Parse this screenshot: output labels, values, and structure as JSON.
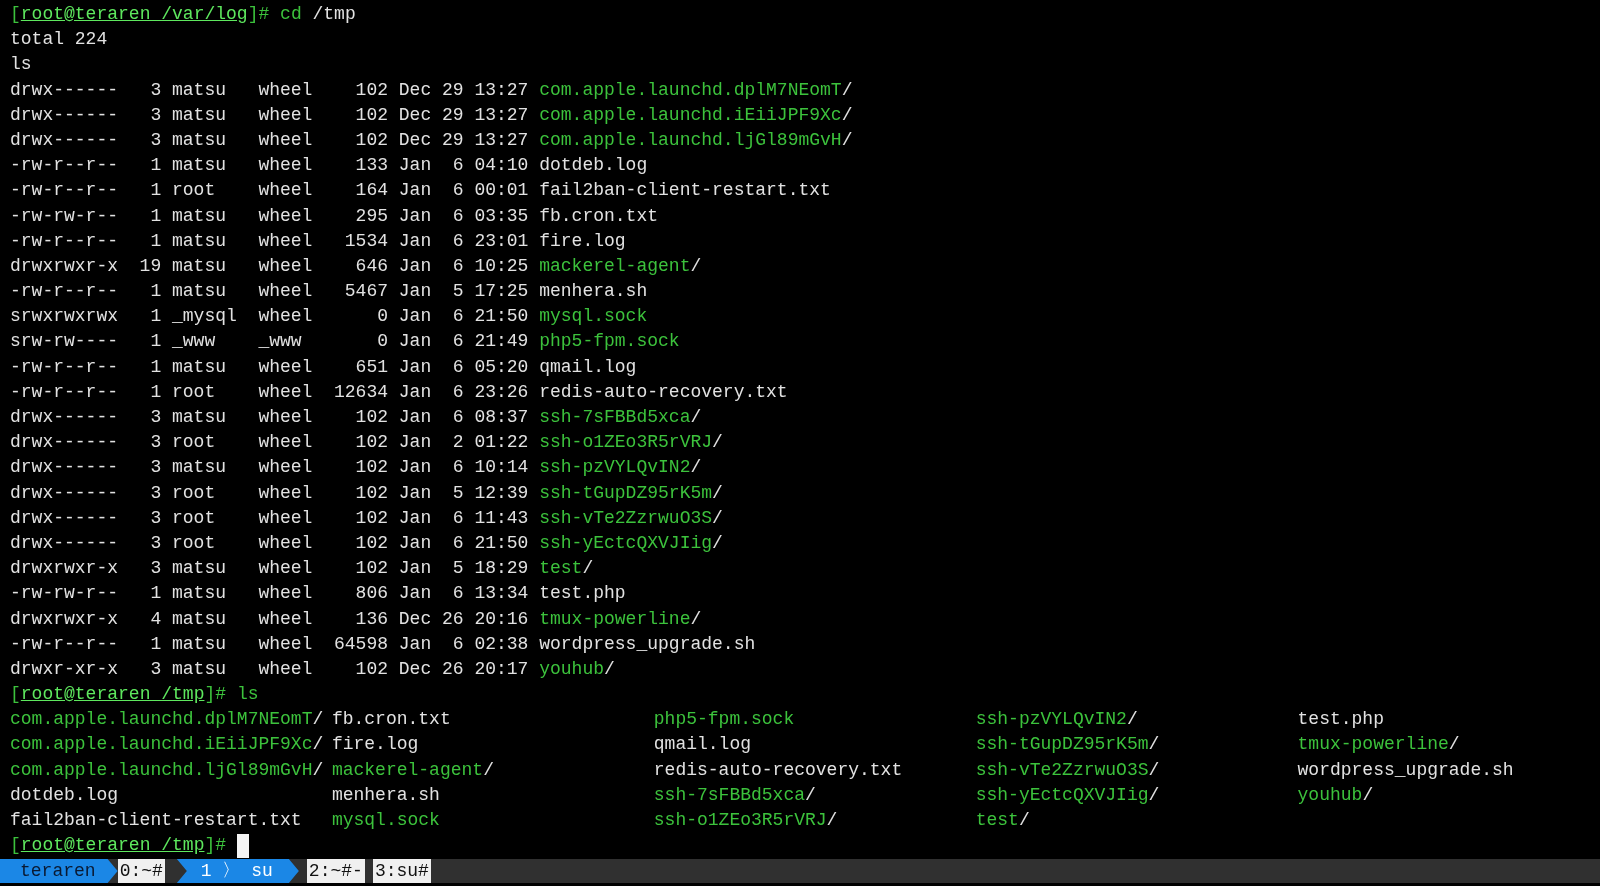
{
  "terminal": {
    "lines": [
      {
        "kind": "prompt",
        "before": "[",
        "location": "root@teraren /var/log",
        "after": "]#",
        "command": "cd",
        "args": "/tmp",
        "cursor": false
      },
      {
        "kind": "text",
        "text": "total 224"
      },
      {
        "kind": "text",
        "text": "ls"
      },
      {
        "kind": "entry",
        "perms": "drwx------",
        "links": "3",
        "owner": "matsu",
        "group": "wheel",
        "size": "102",
        "month": "Dec",
        "day": "29",
        "time": "13:27",
        "name": "com.apple.launchd.dplM7NEomT",
        "suffix": "/",
        "highlight": true
      },
      {
        "kind": "entry",
        "perms": "drwx------",
        "links": "3",
        "owner": "matsu",
        "group": "wheel",
        "size": "102",
        "month": "Dec",
        "day": "29",
        "time": "13:27",
        "name": "com.apple.launchd.iEiiJPF9Xc",
        "suffix": "/",
        "highlight": true
      },
      {
        "kind": "entry",
        "perms": "drwx------",
        "links": "3",
        "owner": "matsu",
        "group": "wheel",
        "size": "102",
        "month": "Dec",
        "day": "29",
        "time": "13:27",
        "name": "com.apple.launchd.ljGl89mGvH",
        "suffix": "/",
        "highlight": true
      },
      {
        "kind": "entry",
        "perms": "-rw-r--r--",
        "links": "1",
        "owner": "matsu",
        "group": "wheel",
        "size": "133",
        "month": "Jan",
        "day": "6",
        "time": "04:10",
        "name": "dotdeb.log",
        "highlight": false
      },
      {
        "kind": "entry",
        "perms": "-rw-r--r--",
        "links": "1",
        "owner": "root",
        "group": "wheel",
        "size": "164",
        "month": "Jan",
        "day": "6",
        "time": "00:01",
        "name": "fail2ban-client-restart.txt",
        "highlight": false
      },
      {
        "kind": "entry",
        "perms": "-rw-rw-r--",
        "links": "1",
        "owner": "matsu",
        "group": "wheel",
        "size": "295",
        "month": "Jan",
        "day": "6",
        "time": "03:35",
        "name": "fb.cron.txt",
        "highlight": false
      },
      {
        "kind": "entry",
        "perms": "-rw-r--r--",
        "links": "1",
        "owner": "matsu",
        "group": "wheel",
        "size": "1534",
        "month": "Jan",
        "day": "6",
        "time": "23:01",
        "name": "fire.log",
        "highlight": false
      },
      {
        "kind": "entry",
        "perms": "drwxrwxr-x",
        "links": "19",
        "owner": "matsu",
        "group": "wheel",
        "size": "646",
        "month": "Jan",
        "day": "6",
        "time": "10:25",
        "name": "mackerel-agent",
        "suffix": "/",
        "highlight": true
      },
      {
        "kind": "entry",
        "perms": "-rw-r--r--",
        "links": "1",
        "owner": "matsu",
        "group": "wheel",
        "size": "5467",
        "month": "Jan",
        "day": "5",
        "time": "17:25",
        "name": "menhera.sh",
        "highlight": false
      },
      {
        "kind": "entry",
        "perms": "srwxrwxrwx",
        "links": "1",
        "owner": "_mysql",
        "group": "wheel",
        "size": "0",
        "month": "Jan",
        "day": "6",
        "time": "21:50",
        "name": "mysql.sock",
        "highlight": true
      },
      {
        "kind": "entry",
        "perms": "srw-rw----",
        "links": "1",
        "owner": "_www",
        "group": "_www",
        "size": "0",
        "month": "Jan",
        "day": "6",
        "time": "21:49",
        "name": "php5-fpm.sock",
        "highlight": true
      },
      {
        "kind": "entry",
        "perms": "-rw-r--r--",
        "links": "1",
        "owner": "matsu",
        "group": "wheel",
        "size": "651",
        "month": "Jan",
        "day": "6",
        "time": "05:20",
        "name": "qmail.log",
        "highlight": false
      },
      {
        "kind": "entry",
        "perms": "-rw-r--r--",
        "links": "1",
        "owner": "root",
        "group": "wheel",
        "size": "12634",
        "month": "Jan",
        "day": "6",
        "time": "23:26",
        "name": "redis-auto-recovery.txt",
        "highlight": false
      },
      {
        "kind": "entry",
        "perms": "drwx------",
        "links": "3",
        "owner": "matsu",
        "group": "wheel",
        "size": "102",
        "month": "Jan",
        "day": "6",
        "time": "08:37",
        "name": "ssh-7sFBBd5xca",
        "suffix": "/",
        "highlight": true
      },
      {
        "kind": "entry",
        "perms": "drwx------",
        "links": "3",
        "owner": "root",
        "group": "wheel",
        "size": "102",
        "month": "Jan",
        "day": "2",
        "time": "01:22",
        "name": "ssh-o1ZEo3R5rVRJ",
        "suffix": "/",
        "highlight": true
      },
      {
        "kind": "entry",
        "perms": "drwx------",
        "links": "3",
        "owner": "matsu",
        "group": "wheel",
        "size": "102",
        "month": "Jan",
        "day": "6",
        "time": "10:14",
        "name": "ssh-pzVYLQvIN2",
        "suffix": "/",
        "highlight": true
      },
      {
        "kind": "entry",
        "perms": "drwx------",
        "links": "3",
        "owner": "root",
        "group": "wheel",
        "size": "102",
        "month": "Jan",
        "day": "5",
        "time": "12:39",
        "name": "ssh-tGupDZ95rK5m",
        "suffix": "/",
        "highlight": true
      },
      {
        "kind": "entry",
        "perms": "drwx------",
        "links": "3",
        "owner": "root",
        "group": "wheel",
        "size": "102",
        "month": "Jan",
        "day": "6",
        "time": "11:43",
        "name": "ssh-vTe2ZzrwuO3S",
        "suffix": "/",
        "highlight": true
      },
      {
        "kind": "entry",
        "perms": "drwx------",
        "links": "3",
        "owner": "root",
        "group": "wheel",
        "size": "102",
        "month": "Jan",
        "day": "6",
        "time": "21:50",
        "name": "ssh-yEctcQXVJIig",
        "suffix": "/",
        "highlight": true
      },
      {
        "kind": "entry",
        "perms": "drwxrwxr-x",
        "links": "3",
        "owner": "matsu",
        "group": "wheel",
        "size": "102",
        "month": "Jan",
        "day": "5",
        "time": "18:29",
        "name": "test",
        "suffix": "/",
        "highlight": true
      },
      {
        "kind": "entry",
        "perms": "-rw-rw-r--",
        "links": "1",
        "owner": "matsu",
        "group": "wheel",
        "size": "806",
        "month": "Jan",
        "day": "6",
        "time": "13:34",
        "name": "test.php",
        "highlight": false
      },
      {
        "kind": "entry",
        "perms": "drwxrwxr-x",
        "links": "4",
        "owner": "matsu",
        "group": "wheel",
        "size": "136",
        "month": "Dec",
        "day": "26",
        "time": "20:16",
        "name": "tmux-powerline",
        "suffix": "/",
        "highlight": true
      },
      {
        "kind": "entry",
        "perms": "-rw-r--r--",
        "links": "1",
        "owner": "matsu",
        "group": "wheel",
        "size": "64598",
        "month": "Jan",
        "day": "6",
        "time": "02:38",
        "name": "wordpress_upgrade.sh",
        "highlight": false
      },
      {
        "kind": "entry",
        "perms": "drwxr-xr-x",
        "links": "3",
        "owner": "matsu",
        "group": "wheel",
        "size": "102",
        "month": "Dec",
        "day": "26",
        "time": "20:17",
        "name": "youhub",
        "suffix": "/",
        "highlight": true
      },
      {
        "kind": "prompt",
        "before": "[",
        "location": "root@teraren /tmp",
        "after": "]#",
        "command": "ls",
        "cursor": false
      },
      {
        "kind": "grid",
        "columns": [
          [
            {
              "name": "com.apple.launchd.dplM7NEomT",
              "suffix": "/",
              "highlight": true
            },
            {
              "name": "com.apple.launchd.iEiiJPF9Xc",
              "suffix": "/",
              "highlight": true
            },
            {
              "name": "com.apple.launchd.ljGl89mGvH",
              "suffix": "/",
              "highlight": true
            },
            {
              "name": "dotdeb.log",
              "highlight": false
            },
            {
              "name": "fail2ban-client-restart.txt",
              "highlight": false
            }
          ],
          [
            {
              "name": "fb.cron.txt",
              "highlight": false
            },
            {
              "name": "fire.log",
              "highlight": false
            },
            {
              "name": "mackerel-agent",
              "suffix": "/",
              "highlight": true
            },
            {
              "name": "menhera.sh",
              "highlight": false
            },
            {
              "name": "mysql.sock",
              "highlight": true
            }
          ],
          [
            {
              "name": "php5-fpm.sock",
              "highlight": true
            },
            {
              "name": "qmail.log",
              "highlight": false
            },
            {
              "name": "redis-auto-recovery.txt",
              "highlight": false
            },
            {
              "name": "ssh-7sFBBd5xca",
              "suffix": "/",
              "highlight": true
            },
            {
              "name": "ssh-o1ZEo3R5rVRJ",
              "suffix": "/",
              "highlight": true
            }
          ],
          [
            {
              "name": "ssh-pzVYLQvIN2",
              "suffix": "/",
              "highlight": true
            },
            {
              "name": "ssh-tGupDZ95rK5m",
              "suffix": "/",
              "highlight": true
            },
            {
              "name": "ssh-vTe2ZzrwuO3S",
              "suffix": "/",
              "highlight": true
            },
            {
              "name": "ssh-yEctcQXVJIig",
              "suffix": "/",
              "highlight": true
            },
            {
              "name": "test",
              "suffix": "/",
              "highlight": true
            }
          ],
          [
            {
              "name": "test.php",
              "highlight": false
            },
            {
              "name": "tmux-powerline",
              "suffix": "/",
              "highlight": true
            },
            {
              "name": "wordpress_upgrade.sh",
              "highlight": false
            },
            {
              "name": "youhub",
              "suffix": "/",
              "highlight": true
            }
          ]
        ]
      },
      {
        "kind": "prompt",
        "before": "[",
        "location": "root@teraren /tmp",
        "after": "]#",
        "cursor": true
      }
    ]
  },
  "status_bar": {
    "session": "teraren",
    "windows": [
      {
        "label": "0:~#",
        "selected": false
      },
      {
        "label": "1 〉 su",
        "selected": true
      },
      {
        "label": "2:~#-",
        "selected": false
      },
      {
        "label": "3:su#",
        "selected": false
      }
    ]
  }
}
